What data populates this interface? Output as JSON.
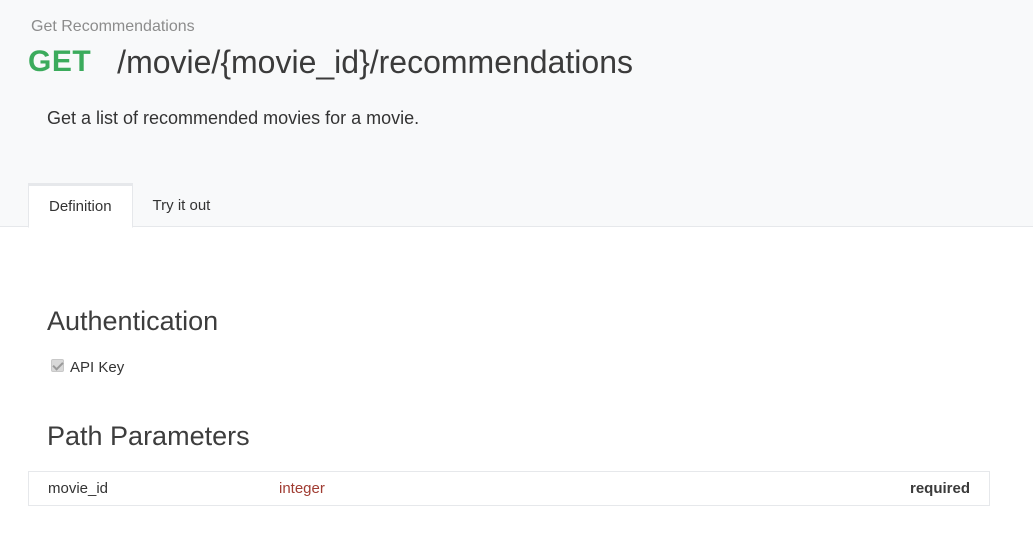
{
  "header": {
    "breadcrumb": "Get Recommendations",
    "method": "GET",
    "method_color": "#3bab5c",
    "path": "/movie/{movie_id}/recommendations",
    "description": "Get a list of recommended movies for a movie."
  },
  "tabs": [
    {
      "label": "Definition",
      "active": true
    },
    {
      "label": "Try it out",
      "active": false
    }
  ],
  "authentication": {
    "title": "Authentication",
    "items": [
      {
        "label": "API Key",
        "checked": true,
        "disabled": true
      }
    ]
  },
  "path_parameters": {
    "title": "Path Parameters",
    "rows": [
      {
        "name": "movie_id",
        "type": "integer",
        "required_label": "required"
      }
    ]
  }
}
